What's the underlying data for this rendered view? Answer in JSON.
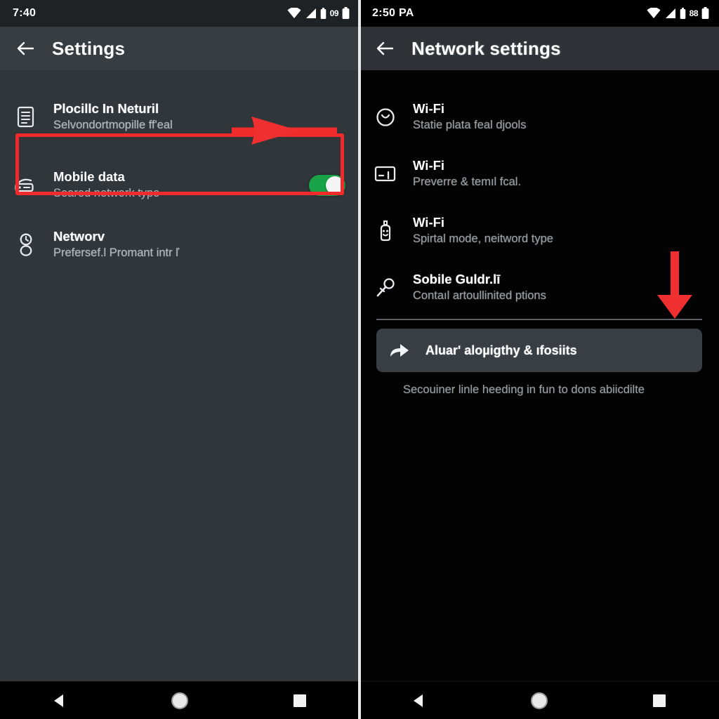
{
  "left_phone": {
    "status_bar": {
      "time": "7:40",
      "battery_percent": "09",
      "icons": [
        "wifi-icon",
        "signal-icon",
        "battery-small-icon",
        "battery-icon"
      ]
    },
    "app_bar": {
      "back": "back-arrow-icon",
      "title": "Settings"
    },
    "rows": [
      {
        "icon": "document-list-icon",
        "title": "Plocillc In Neturil",
        "subtitle": "Selvondortmopille ff'eal",
        "has_toggle": false
      },
      {
        "icon": "router-icon",
        "title": "Mobile data",
        "subtitle": "Seared network type",
        "has_toggle": true,
        "toggle_state": "on",
        "highlighted": true
      },
      {
        "icon": "account-pin-icon",
        "title": "Networv",
        "subtitle": "Prefersef.l Promant intr ľ",
        "has_toggle": false
      }
    ],
    "nav_bar": [
      "back-triangle-icon",
      "home-circle-icon",
      "recents-square-icon"
    ]
  },
  "right_phone": {
    "status_bar": {
      "time": "2:50 PA",
      "battery_percent": "88",
      "icons": [
        "wifi-icon",
        "signal-icon",
        "battery-small-icon",
        "battery-icon"
      ]
    },
    "app_bar": {
      "back": "back-arrow-icon",
      "title": "Network settings"
    },
    "rows": [
      {
        "icon": "clock-face-icon",
        "title": "Wi-Fi",
        "subtitle": "Statie plata feal djools"
      },
      {
        "icon": "card-icon",
        "title": "Wi-Fi",
        "subtitle": "Preverre & temıl fcal."
      },
      {
        "icon": "smiley-bottle-icon",
        "title": "Wi-Fi",
        "subtitle": "Spirtal mode, neitword type"
      },
      {
        "icon": "wand-icon",
        "title": "Sobile Guldr.lī",
        "subtitle": "Contaıl artoullinited ptions"
      }
    ],
    "highlight": {
      "icon": "share-arrow-icon",
      "label": "Aluarʹ aloµigthy & ıfosiits"
    },
    "caption": "Secouiner linle heeding in fun to dons abiicdilte",
    "nav_bar": [
      "back-triangle-icon",
      "home-circle-icon",
      "recents-square-icon"
    ]
  },
  "annotations": {
    "box_color": "#ef2b2b",
    "arrow_color": "#f03030",
    "right_arrow": "arrow-pointing-right",
    "down_arrow": "arrow-pointing-down"
  }
}
